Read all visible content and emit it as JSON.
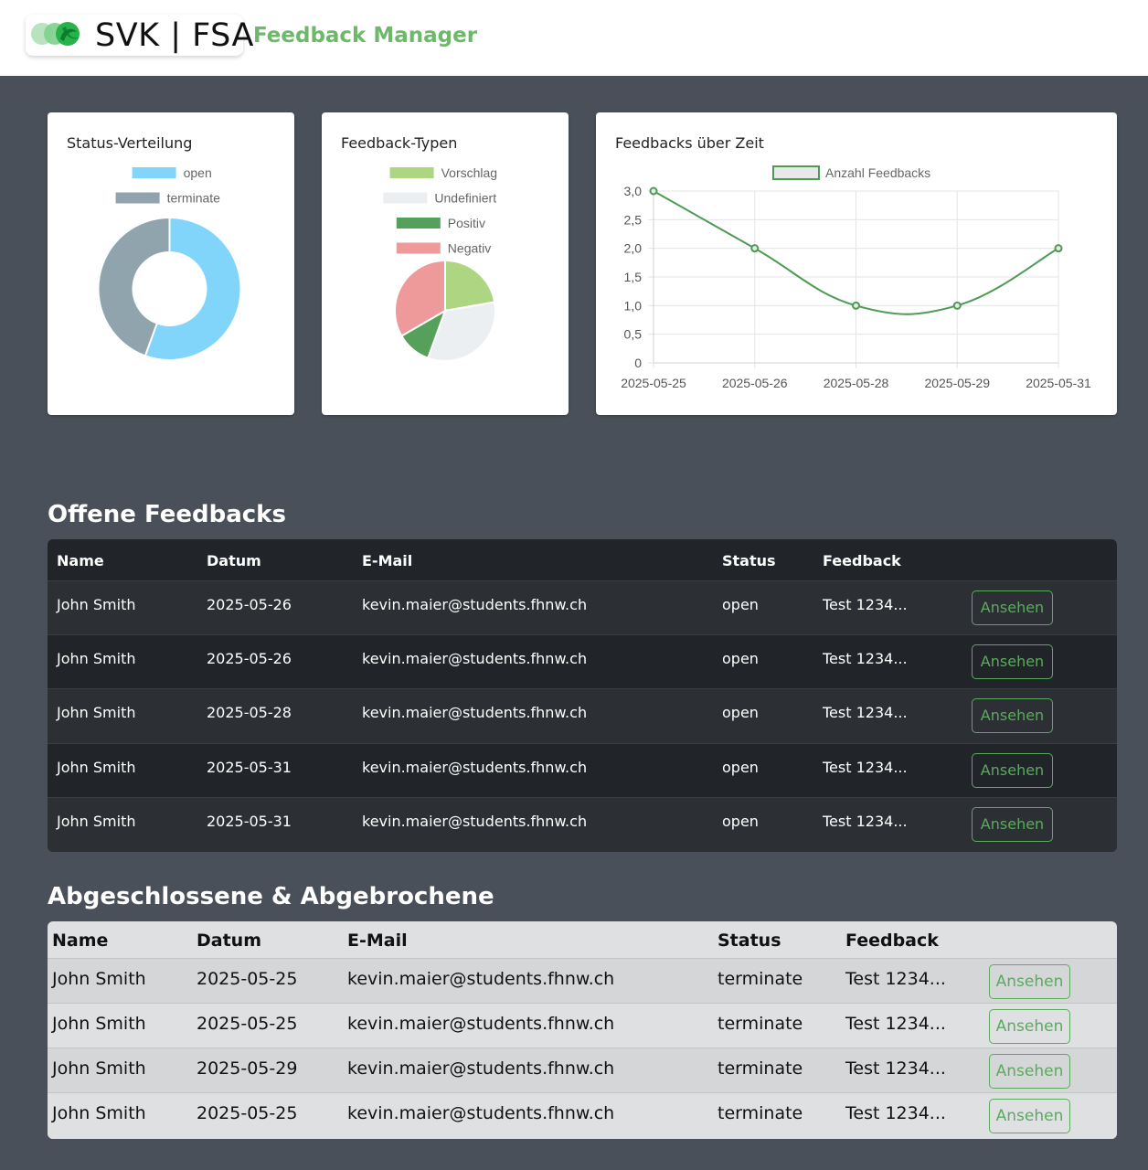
{
  "header": {
    "logo_text": "SVK | FSA",
    "title": "Feedback Manager"
  },
  "colors": {
    "accent_green": "#6db86a",
    "button_green": "#5caa5e",
    "open": "#81d4fa",
    "terminate": "#90a4ae",
    "vorschlag": "#aed581",
    "undefiniert": "#eceff1",
    "positiv": "#55a05a",
    "negativ": "#ef9a9a"
  },
  "charts": {
    "status": {
      "title": "Status-Verteilung"
    },
    "types": {
      "title": "Feedback-Typen"
    },
    "time": {
      "title": "Feedbacks über Zeit"
    }
  },
  "chart_data": [
    {
      "type": "pie",
      "variant": "doughnut",
      "title": "Status-Verteilung",
      "categories": [
        "open",
        "terminate"
      ],
      "values": [
        5,
        4
      ],
      "colors": [
        "#81d4fa",
        "#90a4ae"
      ],
      "legend": "top"
    },
    {
      "type": "pie",
      "title": "Feedback-Typen",
      "categories": [
        "Vorschlag",
        "Undefiniert",
        "Positiv",
        "Negativ"
      ],
      "values": [
        2,
        3,
        1,
        3
      ],
      "colors": [
        "#aed581",
        "#eceff1",
        "#55a05a",
        "#ef9a9a"
      ],
      "legend": "top"
    },
    {
      "type": "line",
      "title": "Feedbacks über Zeit",
      "categories": [
        "2025-05-25",
        "2025-05-26",
        "2025-05-28",
        "2025-05-29",
        "2025-05-31"
      ],
      "series": [
        {
          "name": "Anzahl Feedbacks",
          "values": [
            3,
            2,
            1,
            1,
            2
          ]
        }
      ],
      "ylim": [
        0,
        3
      ],
      "yticks": [
        "0",
        "0,5",
        "1,0",
        "1,5",
        "2,0",
        "2,5",
        "3,0"
      ],
      "grid": true,
      "legend": "top",
      "color": "#4e9a54"
    }
  ],
  "open_section": {
    "title": "Offene Feedbacks",
    "columns": [
      "Name",
      "Datum",
      "E-Mail",
      "Status",
      "Feedback"
    ],
    "rows": [
      {
        "name": "John Smith",
        "date": "2025-05-26",
        "email": "kevin.maier@students.fhnw.ch",
        "status": "open",
        "feedback": "Test 1234...",
        "action": "Ansehen"
      },
      {
        "name": "John Smith",
        "date": "2025-05-26",
        "email": "kevin.maier@students.fhnw.ch",
        "status": "open",
        "feedback": "Test 1234...",
        "action": "Ansehen"
      },
      {
        "name": "John Smith",
        "date": "2025-05-28",
        "email": "kevin.maier@students.fhnw.ch",
        "status": "open",
        "feedback": "Test 1234...",
        "action": "Ansehen"
      },
      {
        "name": "John Smith",
        "date": "2025-05-31",
        "email": "kevin.maier@students.fhnw.ch",
        "status": "open",
        "feedback": "Test 1234...",
        "action": "Ansehen"
      },
      {
        "name": "John Smith",
        "date": "2025-05-31",
        "email": "kevin.maier@students.fhnw.ch",
        "status": "open",
        "feedback": "Test 1234...",
        "action": "Ansehen"
      }
    ]
  },
  "closed_section": {
    "title": "Abgeschlossene & Abgebrochene",
    "columns": [
      "Name",
      "Datum",
      "E-Mail",
      "Status",
      "Feedback"
    ],
    "rows": [
      {
        "name": "John Smith",
        "date": "2025-05-25",
        "email": "kevin.maier@students.fhnw.ch",
        "status": "terminate",
        "feedback": "Test 1234...",
        "action": "Ansehen"
      },
      {
        "name": "John Smith",
        "date": "2025-05-25",
        "email": "kevin.maier@students.fhnw.ch",
        "status": "terminate",
        "feedback": "Test 1234...",
        "action": "Ansehen"
      },
      {
        "name": "John Smith",
        "date": "2025-05-29",
        "email": "kevin.maier@students.fhnw.ch",
        "status": "terminate",
        "feedback": "Test 1234...",
        "action": "Ansehen"
      },
      {
        "name": "John Smith",
        "date": "2025-05-25",
        "email": "kevin.maier@students.fhnw.ch",
        "status": "terminate",
        "feedback": "Test 1234...",
        "action": "Ansehen"
      }
    ]
  }
}
